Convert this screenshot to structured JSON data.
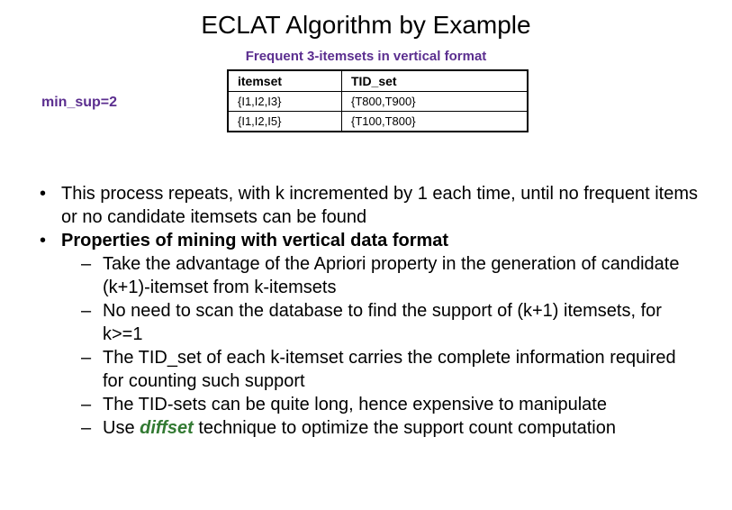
{
  "title": "ECLAT Algorithm by Example",
  "subtitle": "Frequent 3-itemsets in vertical format",
  "min_sup": "min_sup=2",
  "table": {
    "headers": [
      "itemset",
      "TID_set"
    ],
    "rows": [
      [
        "{I1,I2,I3}",
        "{T800,T900}"
      ],
      [
        "{I1,I2,I5}",
        "{T100,T800}"
      ]
    ]
  },
  "bullets": {
    "b1": "This process repeats, with k incremented by 1 each time, until no frequent items or no candidate itemsets can be  found",
    "b2": "Properties of mining with vertical data format",
    "d1": "Take the advantage of the Apriori property in the generation of candidate (k+1)-itemset from k-itemsets",
    "d2": "No need to scan the database to find the support of (k+1) itemsets, for k>=1",
    "d3": "The TID_set of each k-itemset carries the complete information required for counting such support",
    "d4": "The TID-sets can be quite long, hence expensive to manipulate",
    "d5_pre": "Use ",
    "d5_key": "diffset",
    "d5_post": " technique to optimize the support count computation"
  }
}
